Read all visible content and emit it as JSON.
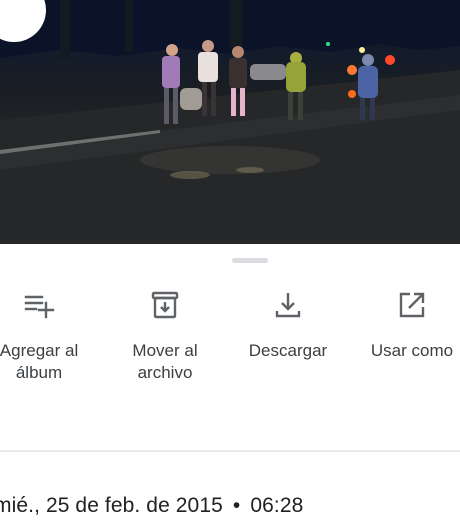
{
  "photo": {
    "icon": "back-arrow-icon"
  },
  "sheet": {
    "actions": [
      {
        "label": "Agregar al\nálbum",
        "icon": "add-to-album-icon"
      },
      {
        "label": "Mover al\narchivo",
        "icon": "archive-icon"
      },
      {
        "label": "Descargar",
        "icon": "download-icon"
      },
      {
        "label": "Usar como",
        "icon": "open-external-icon"
      }
    ],
    "details": {
      "date": "mié., 25 de feb. de 2015",
      "separator": "•",
      "time": "06:28"
    }
  },
  "colors": {
    "icon": "#5f6368",
    "label": "#3c4043",
    "text": "#202124",
    "divider": "#e8eaed",
    "handle": "#dadce0"
  }
}
